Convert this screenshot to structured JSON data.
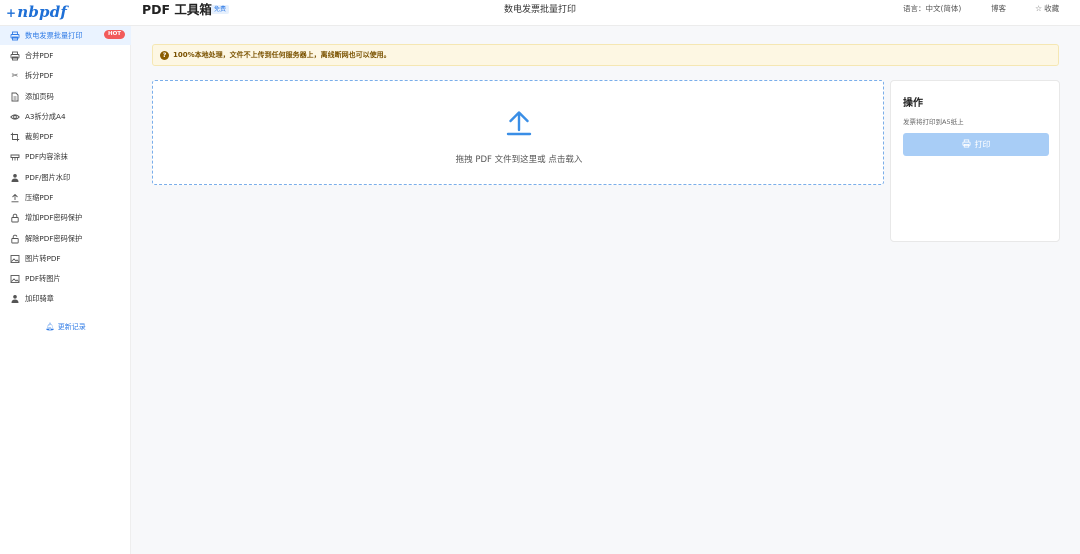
{
  "header": {
    "logo_text": "nbpdf",
    "app_title": "PDF 工具箱",
    "free_badge": "免费",
    "page_title": "数电发票批量打印",
    "language": "语言：中文(简体)",
    "blog": "博客",
    "favorite": "收藏"
  },
  "sidebar": {
    "items": [
      {
        "label": "数电发票批量打印",
        "icon": "printer-icon",
        "active": true,
        "badge": "HOT"
      },
      {
        "label": "合并PDF",
        "icon": "printer-icon"
      },
      {
        "label": "拆分PDF",
        "icon": "scissors-icon"
      },
      {
        "label": "添加页码",
        "icon": "document-icon"
      },
      {
        "label": "A3拆分成A4",
        "icon": "eye-icon"
      },
      {
        "label": "裁剪PDF",
        "icon": "crop-icon"
      },
      {
        "label": "PDF内容涂抹",
        "icon": "eraser-icon"
      },
      {
        "label": "PDF/图片水印",
        "icon": "stamp-icon"
      },
      {
        "label": "压缩PDF",
        "icon": "upload-icon"
      },
      {
        "label": "增加PDF密码保护",
        "icon": "lock-icon"
      },
      {
        "label": "解除PDF密码保护",
        "icon": "unlock-icon"
      },
      {
        "label": "图片转PDF",
        "icon": "image-icon"
      },
      {
        "label": "PDF转图片",
        "icon": "image-icon"
      },
      {
        "label": "加印骑章",
        "icon": "stamp-icon"
      }
    ],
    "changelog": "更新记录"
  },
  "notice": {
    "text": "100%本地处理，文件不上传到任何服务器上，离线断网也可以使用。"
  },
  "dropzone": {
    "text": "拖拽 PDF 文件到这里或 点击载入"
  },
  "panel": {
    "title": "操作",
    "description": "发票将打印到A5纸上",
    "print_button": "打印"
  },
  "colors": {
    "accent": "#2f7be6",
    "hot": "#f25b5b",
    "notice_bg": "#fdf7e3",
    "button_disabled": "#a8cdf6"
  }
}
